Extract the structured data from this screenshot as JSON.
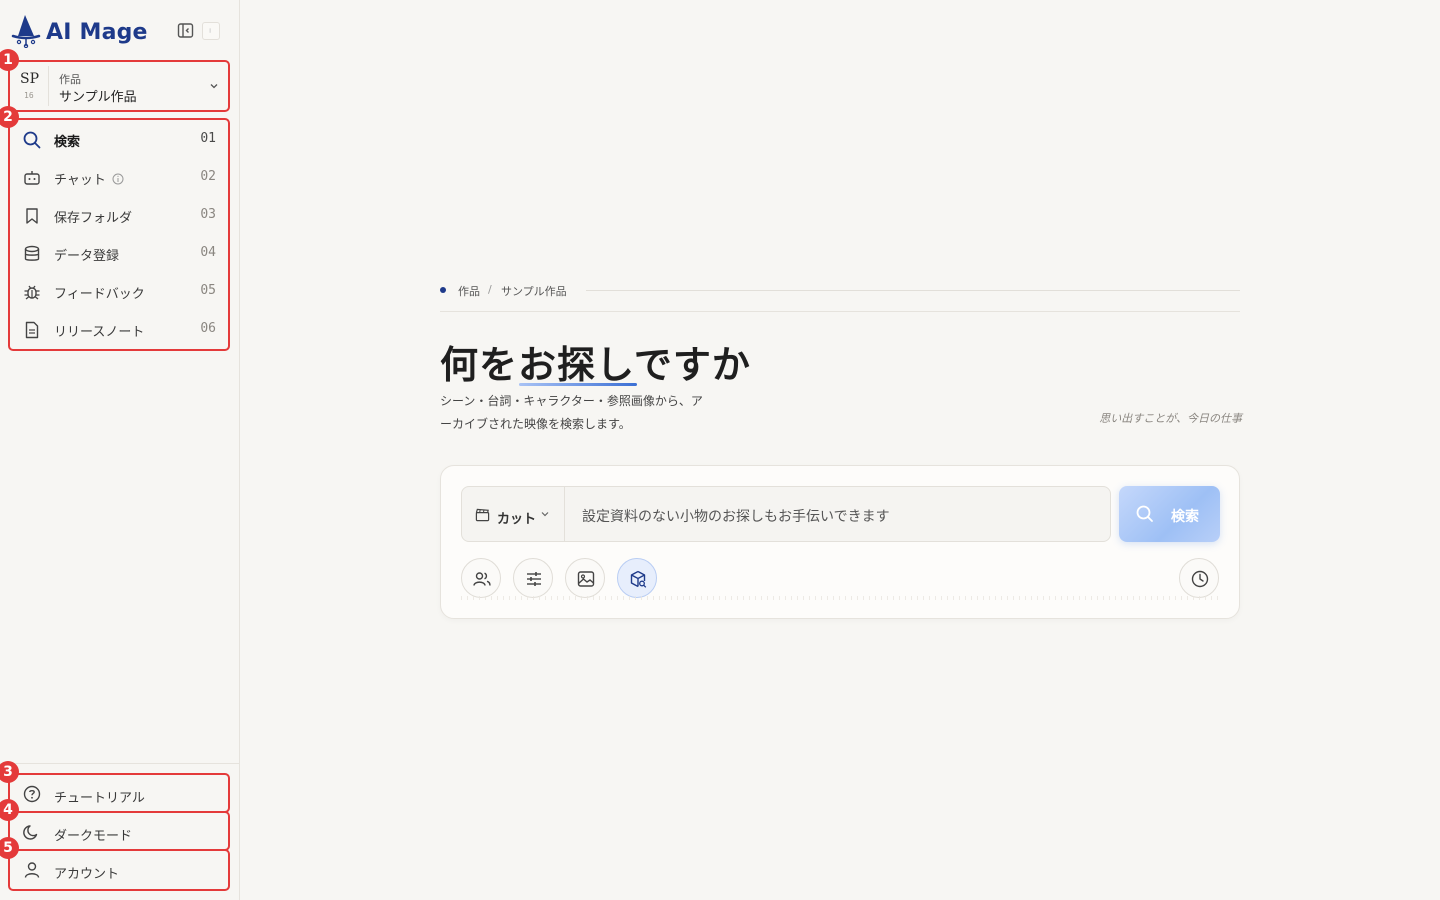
{
  "brand": {
    "name": "AI Mage",
    "color": "#1e3a8a"
  },
  "project": {
    "abbr": "SP",
    "count": "16",
    "caption": "作品",
    "name": "サンプル作品"
  },
  "nav": [
    {
      "label": "検索",
      "index": "01",
      "icon": "search-icon",
      "active": true
    },
    {
      "label": "チャット",
      "index": "02",
      "icon": "robot-icon",
      "active": false
    },
    {
      "label": "保存フォルダ",
      "index": "03",
      "icon": "bookmark-icon",
      "active": false
    },
    {
      "label": "データ登録",
      "index": "04",
      "icon": "database-icon",
      "active": false
    },
    {
      "label": "フィードバック",
      "index": "05",
      "icon": "bug-icon",
      "active": false
    },
    {
      "label": "リリースノート",
      "index": "06",
      "icon": "document-icon",
      "active": false
    }
  ],
  "bottom": {
    "tutorial": "チュートリアル",
    "dark_mode": "ダークモード",
    "account": "アカウント"
  },
  "annotations": [
    "1",
    "2",
    "3",
    "4",
    "5"
  ],
  "breadcrumb": {
    "first": "作品",
    "separator": "/",
    "second": "サンプル作品"
  },
  "hero": {
    "title": "何をお探しですか",
    "subtitle_line1": "シーン・台詞・キャラクター・参照画像から、ア",
    "subtitle_line2": "ーカイブされた映像を検索します。",
    "quote": "思い出すことが、今日の仕事"
  },
  "search": {
    "scope_label": "カット",
    "query": "設定資料のない小物のお探しもお手伝いできます",
    "button_label": "検索"
  },
  "colors": {
    "accent": "#1e3a8a",
    "annotation": "#e43a3a",
    "search_button": "#9ec0f5"
  }
}
